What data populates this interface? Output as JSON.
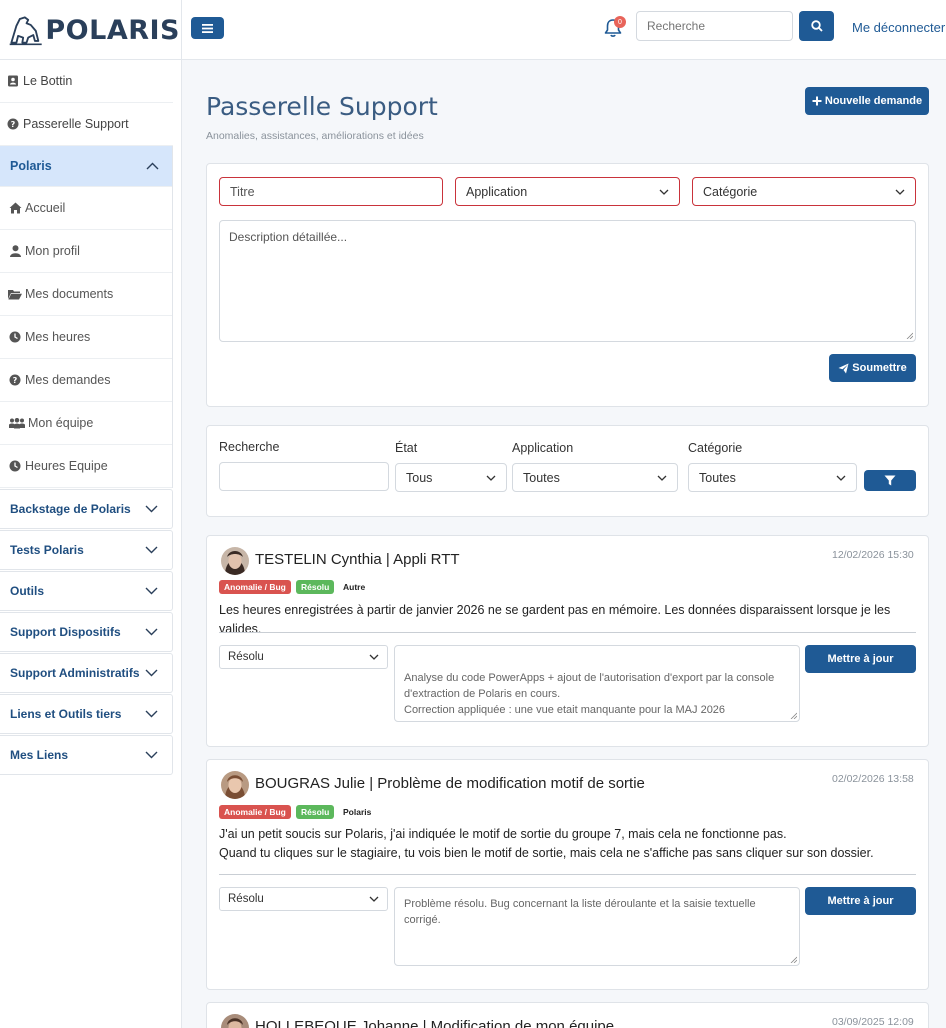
{
  "header": {
    "brand": "POLARIS",
    "notifications_count": "0",
    "search_placeholder": "Recherche",
    "logout_label": "Me déconnecter"
  },
  "sidebar": {
    "top_items": [
      {
        "label": "Le Bottin",
        "icon": "address-card-icon"
      },
      {
        "label": "Passerelle Support",
        "icon": "question-circle-icon"
      }
    ],
    "active_group": {
      "label": "Polaris",
      "expanded": true
    },
    "sub_items": [
      {
        "label": "Accueil",
        "icon": "home-icon"
      },
      {
        "label": "Mon profil",
        "icon": "user-icon"
      },
      {
        "label": "Mes documents",
        "icon": "folder-open-icon"
      },
      {
        "label": "Mes heures",
        "icon": "clock-icon"
      },
      {
        "label": "Mes demandes",
        "icon": "question-circle-icon"
      },
      {
        "label": "Mon équipe",
        "icon": "users-icon"
      },
      {
        "label": "Heures Equipe",
        "icon": "clock-icon"
      }
    ],
    "groups": [
      "Backstage de Polaris",
      "Tests Polaris",
      "Outils",
      "Support Dispositifs",
      "Support Administratifs",
      "Liens et Outils tiers",
      "Mes Liens"
    ]
  },
  "page": {
    "title": "Passerelle Support",
    "subtitle": "Anomalies, assistances, améliorations et idées",
    "new_request_label": "Nouvelle demande"
  },
  "form": {
    "title_placeholder": "Titre",
    "application_placeholder": "Application",
    "category_placeholder": "Catégorie",
    "description_placeholder": "Description détaillée...",
    "submit_label": "Soumettre"
  },
  "filters": {
    "search_label": "Recherche",
    "state_label": "État",
    "state_value": "Tous",
    "application_label": "Application",
    "application_value": "Toutes",
    "category_label": "Catégorie",
    "category_value": "Toutes"
  },
  "tickets": [
    {
      "author_title": "TESTELIN Cynthia | Appli RTT",
      "date": "12/02/2026 15:30",
      "badges": [
        "Anomalie / Bug",
        "Résolu",
        "Autre"
      ],
      "description": "Les heures enregistrées à partir de janvier 2026 ne se gardent pas en mémoire. Les données disparaissent lorsque je les valides.",
      "status": "Résolu",
      "response": "Analyse du code PowerApps + ajout de l'autorisation d'export par la console d'extraction de Polaris en cours.\nCorrection appliquée : une vue etait manquante pour la MAJ 2026",
      "update_label": "Mettre à jour"
    },
    {
      "author_title": "BOUGRAS Julie | Problème de modification motif de sortie",
      "date": "02/02/2026 13:58",
      "badges": [
        "Anomalie / Bug",
        "Résolu",
        "Polaris"
      ],
      "description": "J'ai un petit soucis sur Polaris, j'ai indiquée le motif de sortie du groupe 7, mais cela ne fonctionne pas.\nQuand tu cliques sur le stagiaire, tu vois bien le motif de sortie, mais cela ne s'affiche pas sans cliquer sur son dossier.",
      "status": "Résolu",
      "response": "Problème résolu. Bug concernant la liste déroulante et la saisie textuelle corrigé.",
      "update_label": "Mettre à jour"
    },
    {
      "author_title": "HOLLEBEQUE Johanne | Modification de mon équipe",
      "date": "03/09/2025 12:09"
    }
  ],
  "colors": {
    "primary": "#1f5a95",
    "active_bg": "#d6e6fb",
    "badge_bug": "#d9534f",
    "badge_resolved": "#5cb85c",
    "required_border": "#c9333b"
  }
}
